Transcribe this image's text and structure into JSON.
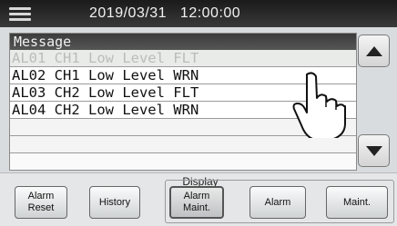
{
  "header": {
    "datetime": "2019/03/31   12:00:00"
  },
  "message_panel": {
    "title": "Message",
    "rows": [
      "AL01 CH1 Low Level FLT",
      "AL02 CH1 Low Level WRN",
      "AL03 CH2 Low Level FLT",
      "AL04 CH2 Low Level WRN"
    ]
  },
  "footer": {
    "group_label": "Display",
    "buttons": {
      "alarm_reset": "Alarm\nReset",
      "history": "History",
      "alarm_maint": "Alarm\nMaint.",
      "alarm": "Alarm",
      "maint": "Maint."
    }
  },
  "icons": [
    "menu-icon",
    "scroll-up-icon",
    "scroll-down-icon",
    "pointing-hand-icon"
  ]
}
